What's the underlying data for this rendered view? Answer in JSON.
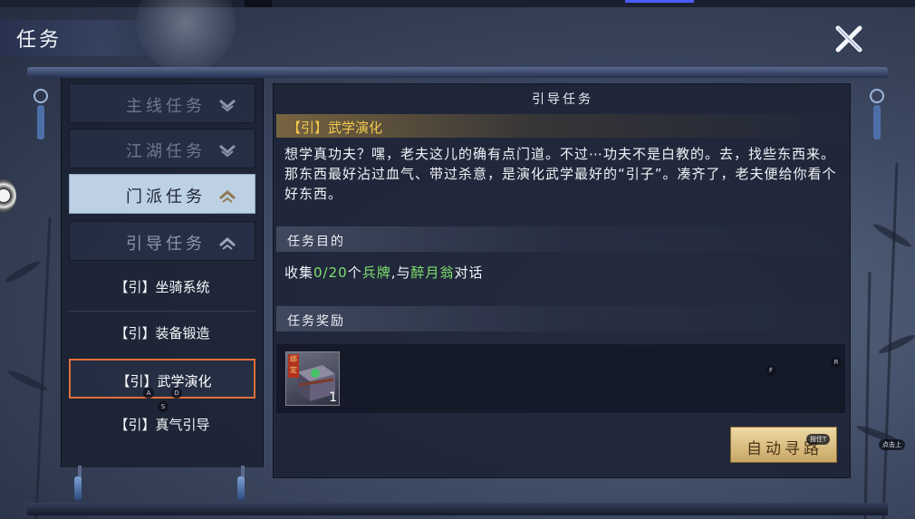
{
  "window": {
    "title": "任务"
  },
  "categories": [
    {
      "label": "主线任务",
      "state": "collapsed"
    },
    {
      "label": "江湖任务",
      "state": "collapsed"
    },
    {
      "label": "门派任务",
      "state": "active"
    },
    {
      "label": "引导任务",
      "state": "expanded"
    }
  ],
  "subitems": [
    {
      "label": "【引】坐骑系统"
    },
    {
      "label": "【引】装备锻造"
    },
    {
      "label": "【引】武学演化",
      "selected": true
    },
    {
      "label": "【引】真气引导"
    }
  ],
  "panel": {
    "title": "引导任务",
    "quest_name": "【引】武学演化",
    "description": "想学真功夫？嘿，老夫这儿的确有点门道。不过⋯功夫不是白教的。去，找些东西来。那东西最好沾过血气、带过杀意，是演化武学最好的“引子”。凑齐了，老夫便给你看个好东西。",
    "objective_header": "任务目的",
    "objective": {
      "prefix": "收集",
      "progress": "0/20",
      "mid1": "个",
      "item": "兵牌",
      "mid2": ",与",
      "npc": "醉月翁",
      "suffix": "对话"
    },
    "reward_header": "任务奖励",
    "reward_item": {
      "qty": "1",
      "tag": "绑定",
      "icon": "box-icon"
    },
    "auto_button": "自动寻路"
  },
  "hotkeys": {
    "a": "A",
    "d": "D",
    "s": "S",
    "f": "F",
    "r": "R"
  },
  "hints": {
    "auto": "按住T",
    "right": "点击上"
  },
  "colors": {
    "accent_gold": "#f2c84b",
    "progress_green": "#7ee06d",
    "selected_border": "#e0703a",
    "active_tab": "#bdd0e4"
  }
}
